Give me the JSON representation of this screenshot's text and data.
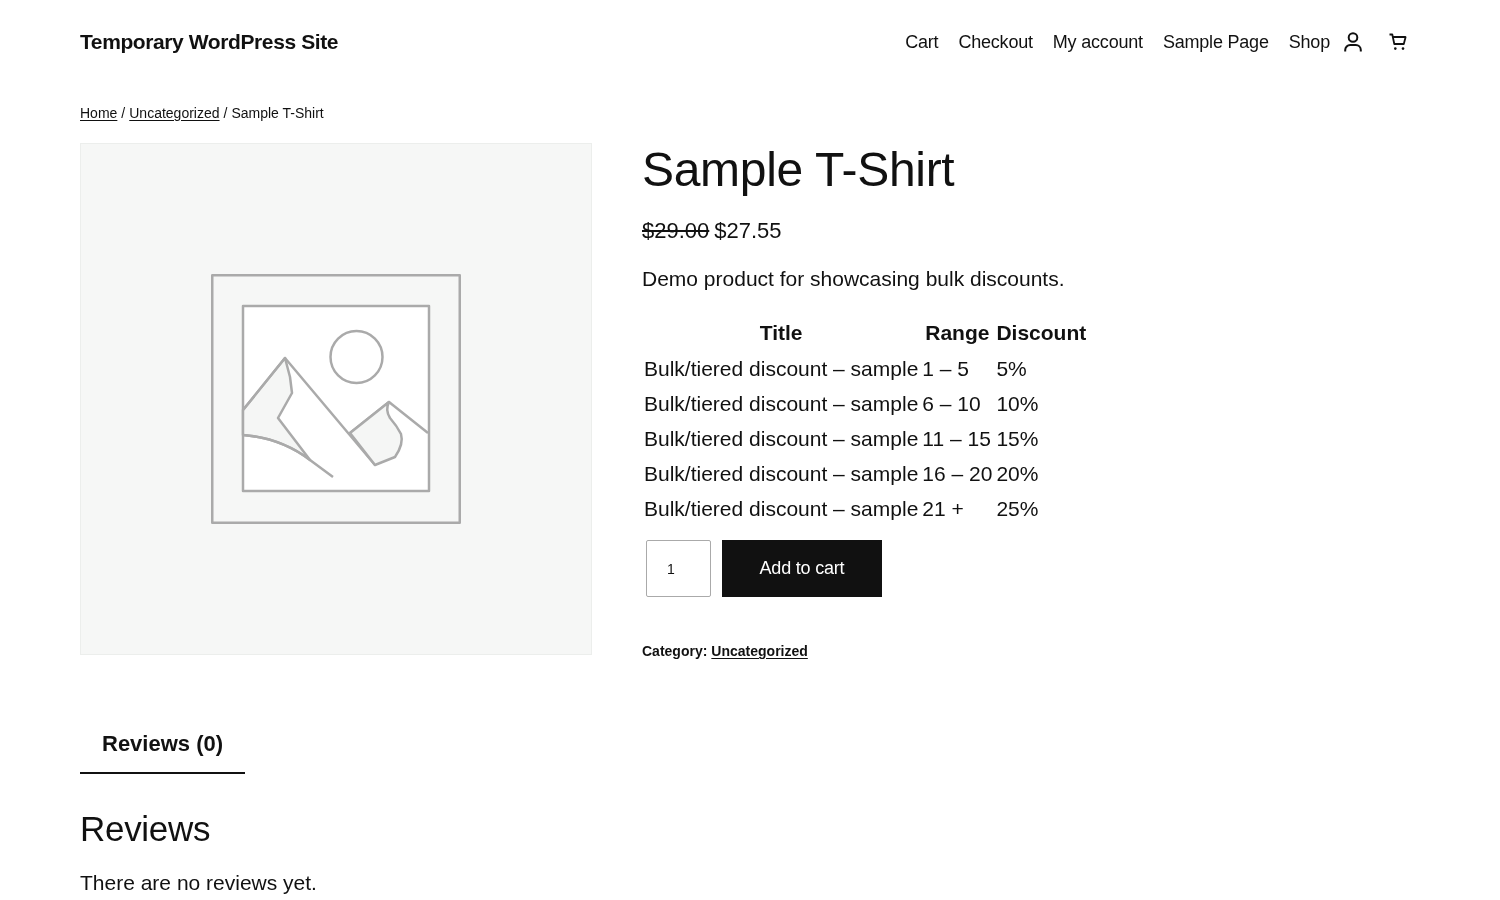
{
  "site": {
    "title": "Temporary WordPress Site"
  },
  "nav": {
    "items": [
      "Cart",
      "Checkout",
      "My account",
      "Sample Page",
      "Shop"
    ]
  },
  "breadcrumb": [
    {
      "kind": "link",
      "label": "Home"
    },
    {
      "kind": "separator",
      "label": "/"
    },
    {
      "kind": "link",
      "label": "Uncategorized"
    },
    {
      "kind": "separator",
      "label": "/"
    },
    {
      "kind": "current",
      "label": "Sample T-Shirt"
    }
  ],
  "product": {
    "title": "Sample T-Shirt",
    "regular_price": "$29.00",
    "sale_price": "$27.55",
    "description": "Demo product for showcasing bulk discounts.",
    "discount_table": {
      "columns": [
        "Title",
        "Range",
        "Discount"
      ],
      "rows": [
        [
          "Bulk/tiered discount – sample",
          "1 – 5",
          "5%"
        ],
        [
          "Bulk/tiered discount – sample",
          "6 – 10",
          "10%"
        ],
        [
          "Bulk/tiered discount – sample",
          "11 – 15",
          "15%"
        ],
        [
          "Bulk/tiered discount – sample",
          "16 – 20",
          "20%"
        ],
        [
          "Bulk/tiered discount – sample",
          "21 +",
          "25%"
        ]
      ]
    },
    "quantity": {
      "value": "1"
    },
    "add_to_cart": "Add to cart",
    "category": {
      "label": "Category:",
      "link": "Uncategorized"
    }
  },
  "tabs": [
    {
      "label": "Reviews (0)",
      "selected": true
    }
  ],
  "reviews": {
    "heading": "Reviews",
    "empty_text": "There are no reviews yet."
  }
}
